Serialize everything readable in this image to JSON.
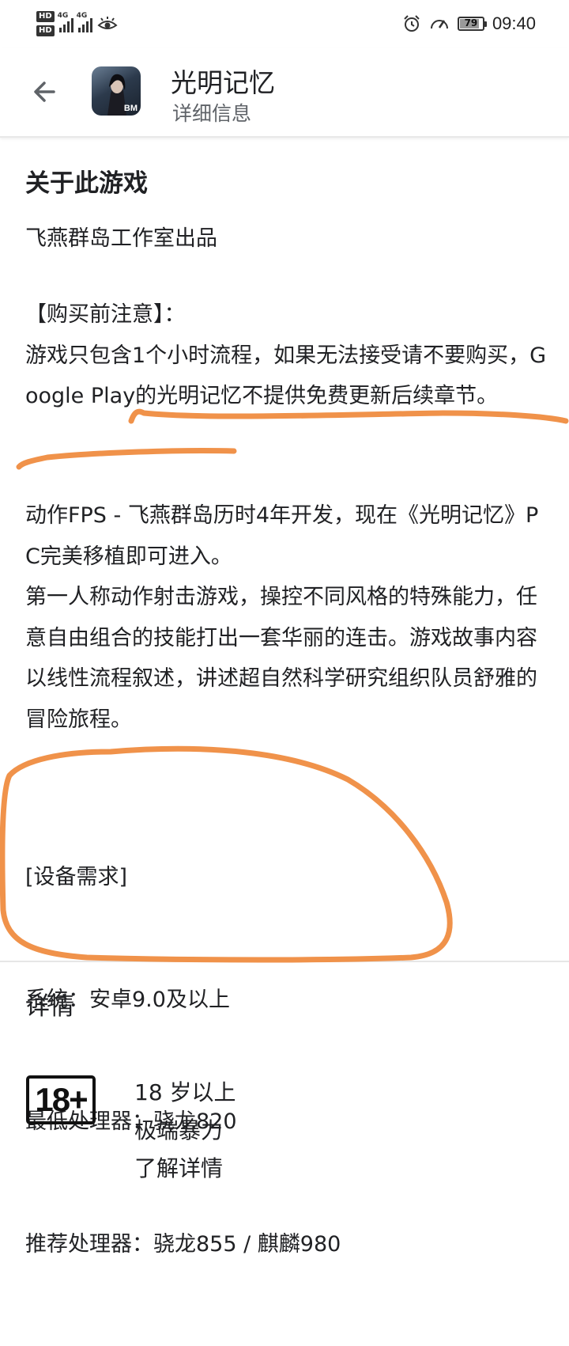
{
  "status_bar": {
    "hd1": "HD",
    "hd2": "HD",
    "net1": "4G",
    "net2": "4G",
    "battery": "79",
    "time": "09:40"
  },
  "app_bar": {
    "back_icon": "arrow-back-icon",
    "title": "光明记忆",
    "subtitle": "详细信息",
    "icon_badge": "BM"
  },
  "about": {
    "heading": "关于此游戏",
    "studio": "飞燕群岛工作室出品",
    "notice": "【购买前注意】：\n游戏只包含1个小时流程，如果无法接受请不要购买，Google Play的光明记忆不提供免费更新后续章节。",
    "description": "动作FPS - 飞燕群岛历时4年开发，现在《光明记忆》PC完美移植即可进入。\n第一人称动作射击游戏，操控不同风格的特殊能力，任意自由组合的技能打出一套华丽的连击。游戏故事内容以线性流程叙述，讲述超自然科学研究组织队员舒雅的冒险旅程。",
    "requirements": {
      "title": "[设备需求]",
      "system": "系统：安卓9.0及以上",
      "min_cpu": "最低处理器：骁龙820",
      "rec_cpu": "推荐处理器：骁龙855 / 麒麟980"
    }
  },
  "details": {
    "heading": "详情",
    "rating_badge": "18+",
    "rating_age": "18 岁以上",
    "rating_reason": "极端暴力",
    "learn_more": "了解详情"
  },
  "colors": {
    "annotation": "#f0924a",
    "text": "#202124",
    "secondary": "#5f6368"
  }
}
